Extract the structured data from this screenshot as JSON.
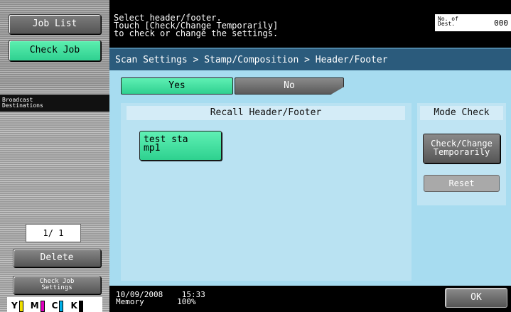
{
  "left_panel": {
    "job_list_label": "Job List",
    "check_job_label": "Check Job",
    "broadcast_header": "Broadcast\nDestinations",
    "page_counter": "1/ 1",
    "delete_label": "Delete",
    "check_job_settings_label": "Check Job\nSettings",
    "toner": [
      {
        "label": "Y",
        "color": "#f0e000"
      },
      {
        "label": "M",
        "color": "#e000c0"
      },
      {
        "label": "C",
        "color": "#00b0e8"
      },
      {
        "label": "K",
        "color": "#000000"
      }
    ]
  },
  "header": {
    "message": "Select header/footer.\nTouch [Check/Change Temporarily]\nto check or change the settings.",
    "dest_label": "No. of\nDest.",
    "dest_value": "000"
  },
  "main": {
    "breadcrumb": "Scan Settings > Stamp/Composition > Header/Footer",
    "yes_label": "Yes",
    "no_label": "No",
    "recall_title": "Recall Header/Footer",
    "stamp_button_label": "test sta\nmp1",
    "mode_check_title": "Mode Check",
    "check_change_label": "Check/Change\nTemporarily",
    "reset_label": "Reset"
  },
  "footer": {
    "status": "10/09/2008    15:33\nMemory       100%",
    "ok_label": "OK"
  },
  "colors": {
    "selected_green": "#3fe0a0",
    "panel_blue": "#a7dcf0",
    "breadcrumb_bar": "#2b5b7c"
  }
}
